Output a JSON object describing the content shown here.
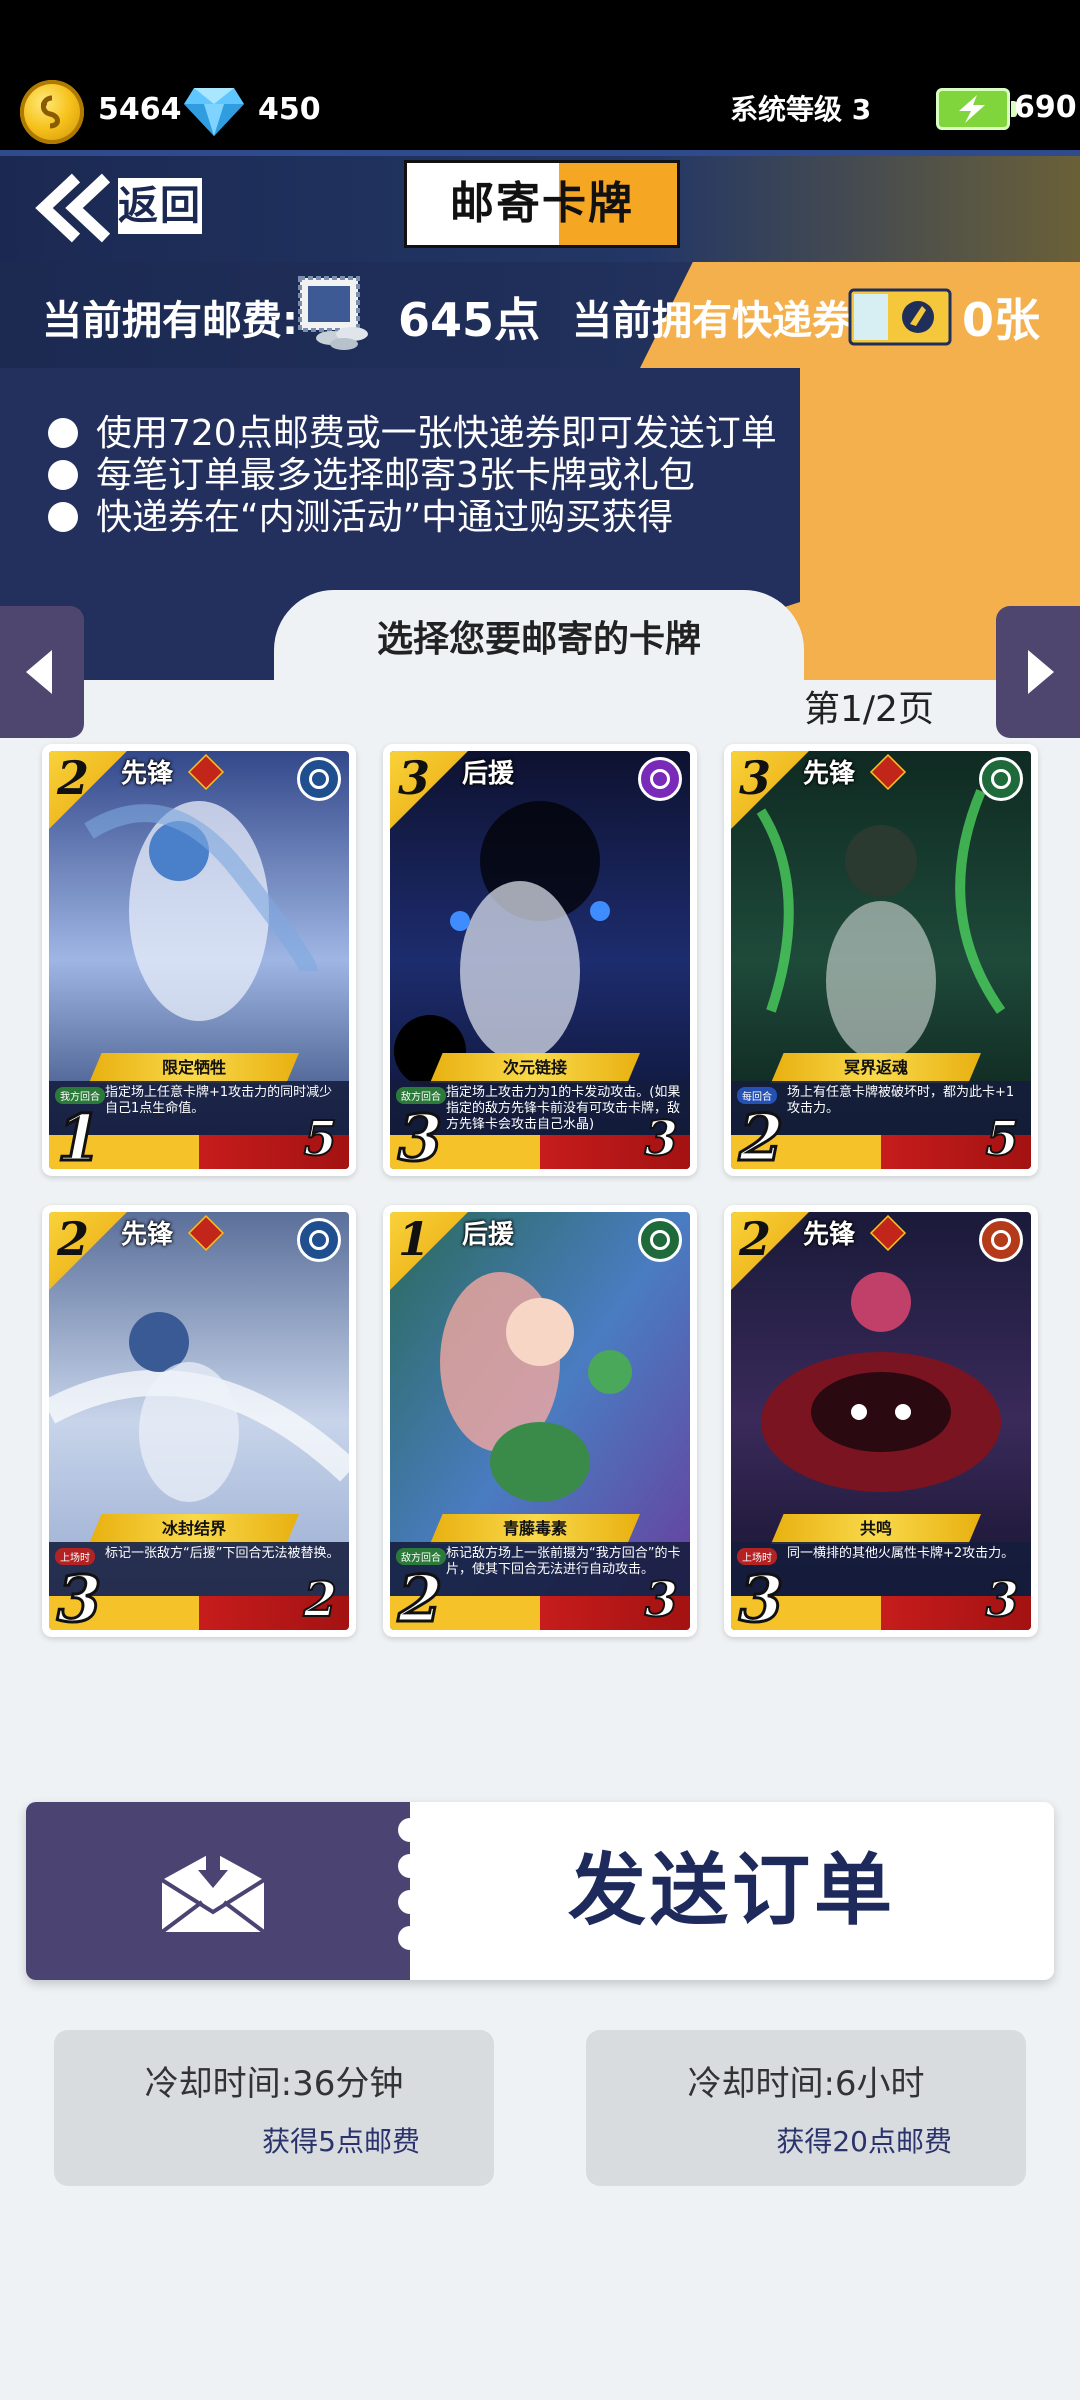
{
  "status": {
    "coins": "5464",
    "gems": "450",
    "system_level": "系统等级 3",
    "energy": "690",
    "coin_icon": "coin-icon",
    "gem_icon": "diamond-icon",
    "energy_icon": "battery-icon"
  },
  "header": {
    "back_label": "返回",
    "title": "邮寄卡牌"
  },
  "postage": {
    "fee_label": "当前拥有邮费:",
    "fee_value": "645点",
    "express_label": "当前拥有快递券:",
    "express_value": "0张"
  },
  "info": {
    "lines": [
      "使用720点邮费或一张快递券即可发送订单",
      "每笔订单最多选择邮寄3张卡牌或礼包",
      "快递券在“内测活动”中通过购买获得"
    ]
  },
  "selection": {
    "title": "选择您要邮寄的卡牌",
    "page": "第1/2页"
  },
  "cards": [
    {
      "cost": "2",
      "role": "先锋",
      "ability": "限定牺牲",
      "tag": "我方回合",
      "desc": "指定场上任意卡牌+1攻击力的同时减少自己1点生命值。",
      "atk": "1",
      "hp": "5"
    },
    {
      "cost": "3",
      "role": "后援",
      "ability": "次元链接",
      "tag": "敌方回合",
      "desc": "指定场上攻击力为1的卡发动攻击。(如果指定的敌方先锋卡前没有可攻击卡牌，敌方先锋卡会攻击自己水晶)",
      "atk": "3",
      "hp": "3"
    },
    {
      "cost": "3",
      "role": "先锋",
      "ability": "冥界返魂",
      "tag": "每回合",
      "desc": "场上有任意卡牌被破坏时，都为此卡+1攻击力。",
      "atk": "2",
      "hp": "5"
    },
    {
      "cost": "2",
      "role": "先锋",
      "ability": "冰封结界",
      "tag": "上场时",
      "desc": "标记一张敌方“后援”下回合无法被替换。",
      "atk": "3",
      "hp": "2"
    },
    {
      "cost": "1",
      "role": "后援",
      "ability": "青藤毒素",
      "tag": "敌方回合",
      "desc": "标记敌方场上一张前摄为“我方回合”的卡片，使其下回合无法进行自动攻击。",
      "atk": "2",
      "hp": "3"
    },
    {
      "cost": "2",
      "role": "先锋",
      "ability": "共鸣",
      "tag": "上场时",
      "desc": "同一横排的其他火属性卡牌+2攻击力。",
      "atk": "3",
      "hp": "3"
    }
  ],
  "send": {
    "label": "发送订单",
    "icon": "envelope-download-icon"
  },
  "cooldowns": [
    {
      "time": "冷却时间:36分钟",
      "reward": "获得5点邮费"
    },
    {
      "time": "冷却时间:6小时",
      "reward": "获得20点邮费"
    }
  ],
  "colors": {
    "navy": "#23305e",
    "accent_orange": "#f4b04c",
    "button_purple": "#4b4473",
    "background": "#eef2f4"
  }
}
